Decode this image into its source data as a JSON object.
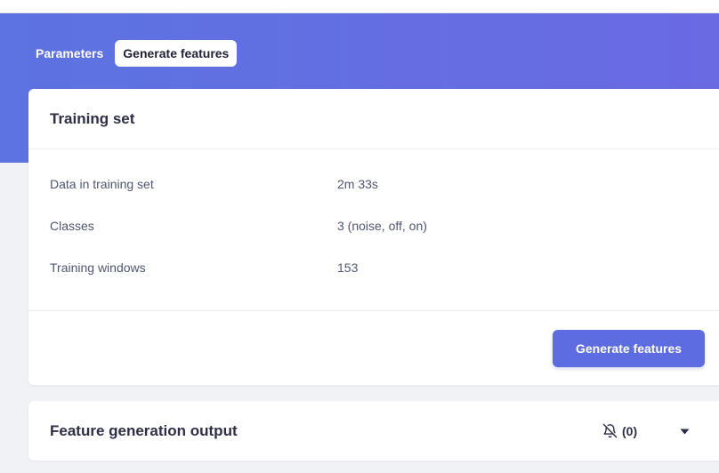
{
  "tabs": [
    {
      "label": "Parameters",
      "active": false
    },
    {
      "label": "Generate features",
      "active": true
    }
  ],
  "training_set": {
    "title": "Training set",
    "rows": [
      {
        "label": "Data in training set",
        "value": "2m 33s"
      },
      {
        "label": "Classes",
        "value": "3 (noise, off, on)"
      },
      {
        "label": "Training windows",
        "value": "153"
      }
    ],
    "button_label": "Generate features"
  },
  "output": {
    "title": "Feature generation output",
    "notification_count": "(0)",
    "icons": {
      "notifications": "bell-off-icon",
      "expand": "caret-down-icon"
    }
  },
  "colors": {
    "hero_start": "#5c73e0",
    "hero_end": "#6a6ae3",
    "primary_button": "#5d6ce0"
  }
}
